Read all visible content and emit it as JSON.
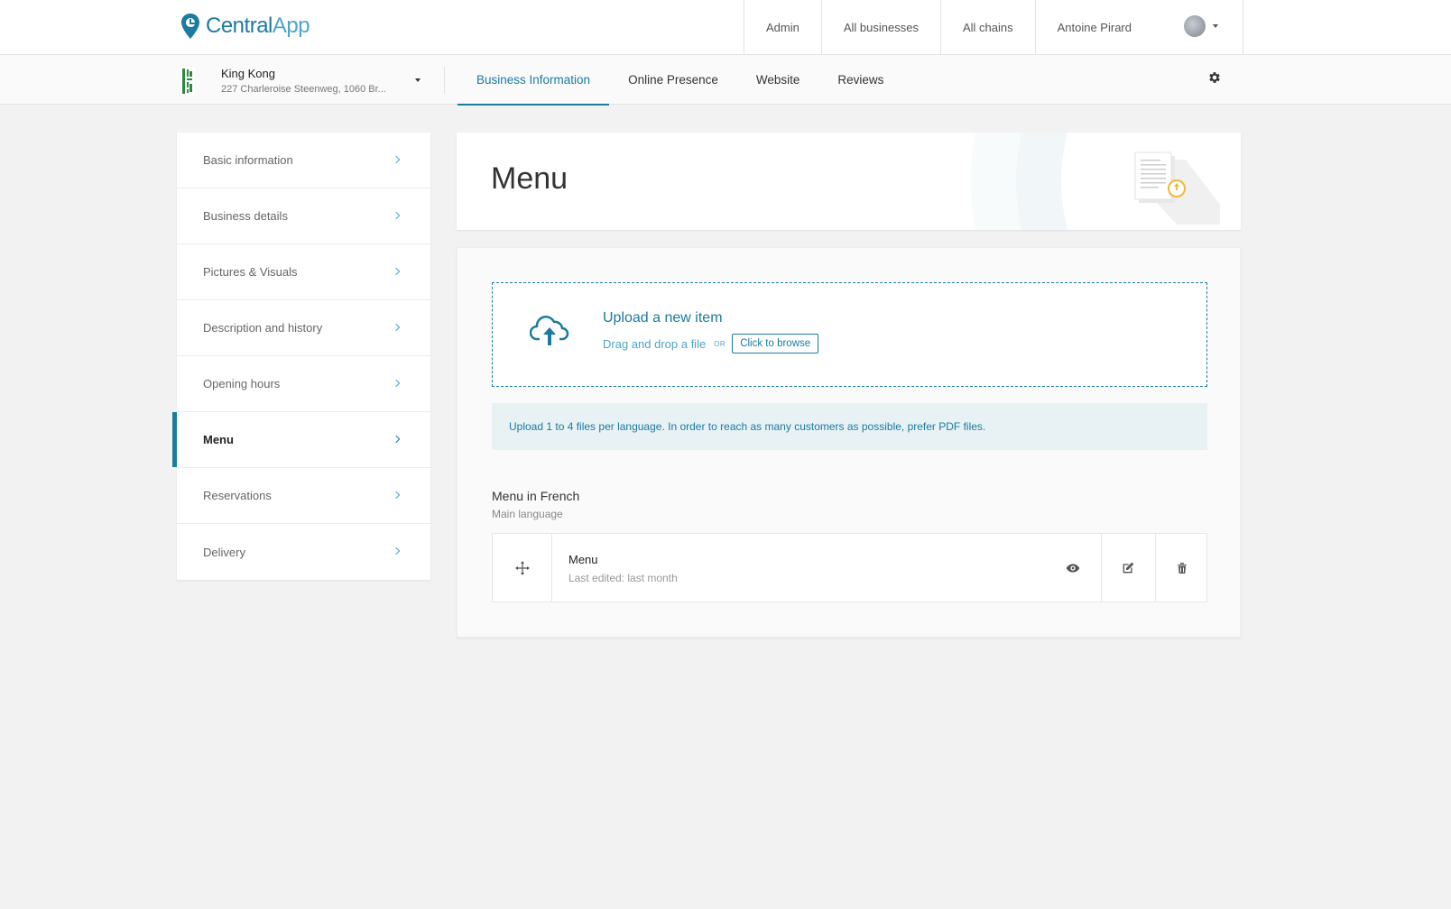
{
  "app": {
    "logo_central": "Central",
    "logo_app": "App",
    "brand_color": "#1b7ba0"
  },
  "topnav": {
    "items": [
      "Admin",
      "All businesses",
      "All chains"
    ],
    "user_name": "Antoine Pirard"
  },
  "business": {
    "name": "King Kong",
    "address": "227 Charleroise Steenweg, 1060 Br..."
  },
  "tabs": [
    "Business Information",
    "Online Presence",
    "Website",
    "Reviews"
  ],
  "active_tab": "Business Information",
  "sidebar": {
    "items": [
      {
        "label": "Basic information"
      },
      {
        "label": "Business details"
      },
      {
        "label": "Pictures & Visuals"
      },
      {
        "label": "Description and history"
      },
      {
        "label": "Opening hours"
      },
      {
        "label": "Menu"
      },
      {
        "label": "Reservations"
      },
      {
        "label": "Delivery"
      }
    ],
    "active": "Menu"
  },
  "page": {
    "title": "Menu"
  },
  "upload": {
    "title": "Upload a new item",
    "drag_text": "Drag and drop a file",
    "or_text": "OR",
    "browse_label": "Click to browse",
    "icon": "cloud-upload-icon"
  },
  "info": {
    "text": "Upload 1 to 4 files per language. In order to reach as many customers as possible, prefer PDF files."
  },
  "section": {
    "title": "Menu in French",
    "subtitle": "Main language"
  },
  "files": [
    {
      "name": "Menu",
      "meta": "Last edited: last month"
    }
  ]
}
